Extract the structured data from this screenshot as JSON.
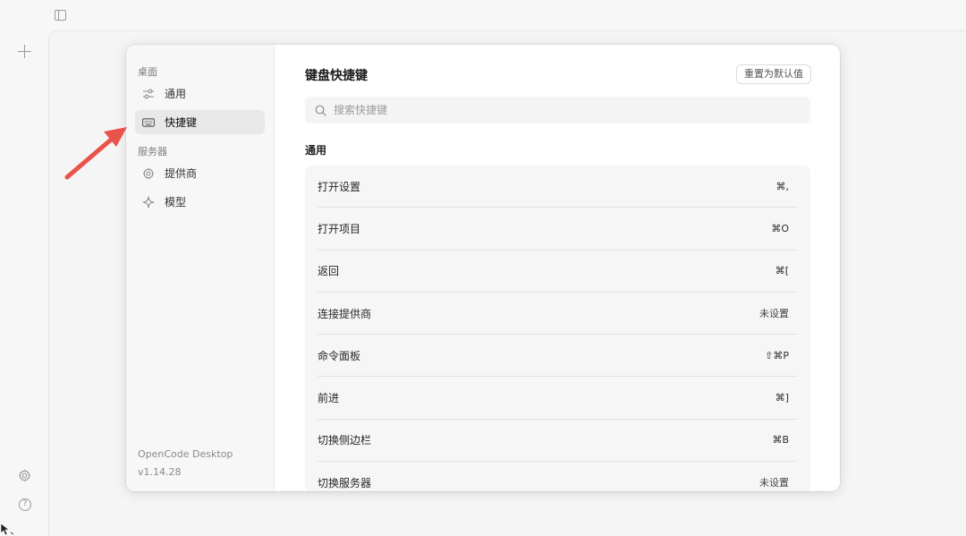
{
  "rail": {
    "icons": [
      "sidebar-toggle-icon",
      "plus-icon",
      "gear-icon",
      "help-icon"
    ],
    "help_glyph": "?"
  },
  "sidebar": {
    "groups": [
      {
        "title": "桌面",
        "items": [
          {
            "label": "通用",
            "icon": "sliders-icon",
            "active": false
          },
          {
            "label": "快捷键",
            "icon": "keyboard-icon",
            "active": true
          }
        ]
      },
      {
        "title": "服务器",
        "items": [
          {
            "label": "提供商",
            "icon": "gear-icon",
            "active": false
          },
          {
            "label": "模型",
            "icon": "sparkle-icon",
            "active": false
          }
        ]
      }
    ],
    "app_name": "OpenCode Desktop",
    "version": "v1.14.28"
  },
  "content": {
    "title": "键盘快捷键",
    "reset_label": "重置为默认值",
    "search_placeholder": "搜索快捷键",
    "section_title": "通用",
    "shortcuts": [
      {
        "label": "打开设置",
        "key": "⌘,"
      },
      {
        "label": "打开项目",
        "key": "⌘O"
      },
      {
        "label": "返回",
        "key": "⌘["
      },
      {
        "label": "连接提供商",
        "key": "未设置"
      },
      {
        "label": "命令面板",
        "key": "⇧⌘P"
      },
      {
        "label": "前进",
        "key": "⌘]"
      },
      {
        "label": "切换侧边栏",
        "key": "⌘B"
      },
      {
        "label": "切换服务器",
        "key": "未设置"
      }
    ]
  },
  "colors": {
    "accent_arrow": "#e8534a",
    "active_bg": "#e8e8e8"
  }
}
